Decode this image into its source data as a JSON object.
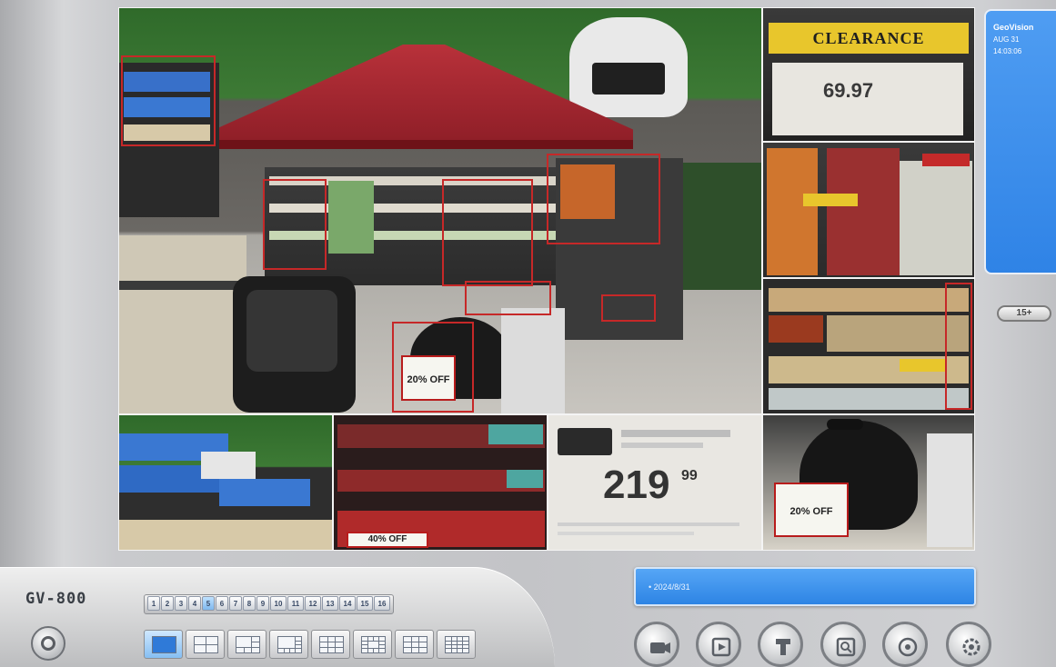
{
  "app": {
    "logo": "GV-800"
  },
  "info_panel": {
    "brand": "GeoVision",
    "date": "AUG 31",
    "time": "14:03:06"
  },
  "zoom_button": {
    "label": "15+"
  },
  "status_bar": {
    "text": "• 2024/8/31"
  },
  "cameras": {
    "main": {
      "price_sign": "20% OFF"
    },
    "top_right": {
      "banner": "CLEARANCE",
      "price": "69.97"
    },
    "bottom_3": {
      "sign": "40% OFF"
    },
    "bottom_4": {
      "price": "219",
      "cents": "99"
    },
    "bottom_5": {
      "sign": "20% OFF"
    }
  },
  "channels": [
    "1",
    "2",
    "3",
    "4",
    "5",
    "6",
    "7",
    "8",
    "9",
    "10",
    "11",
    "12",
    "13",
    "14",
    "15",
    "16"
  ],
  "active_channel_index": 4,
  "layouts": [
    "single",
    "quad",
    "1+5",
    "1+7",
    "nine",
    "1+12",
    "three-by-four",
    "sixteen"
  ],
  "active_layout_index": 0,
  "controls": [
    {
      "name": "camera-control-button",
      "icon": "camera-icon"
    },
    {
      "name": "playback-button",
      "icon": "playback-icon"
    },
    {
      "name": "ptz-button",
      "icon": "ptz-icon"
    },
    {
      "name": "search-button",
      "icon": "search-icon"
    },
    {
      "name": "network-button",
      "icon": "network-icon"
    },
    {
      "name": "settings-button",
      "icon": "settings-icon"
    }
  ],
  "colors": {
    "accent_blue": "#3b8ef0",
    "alarm_red": "#c62828"
  }
}
